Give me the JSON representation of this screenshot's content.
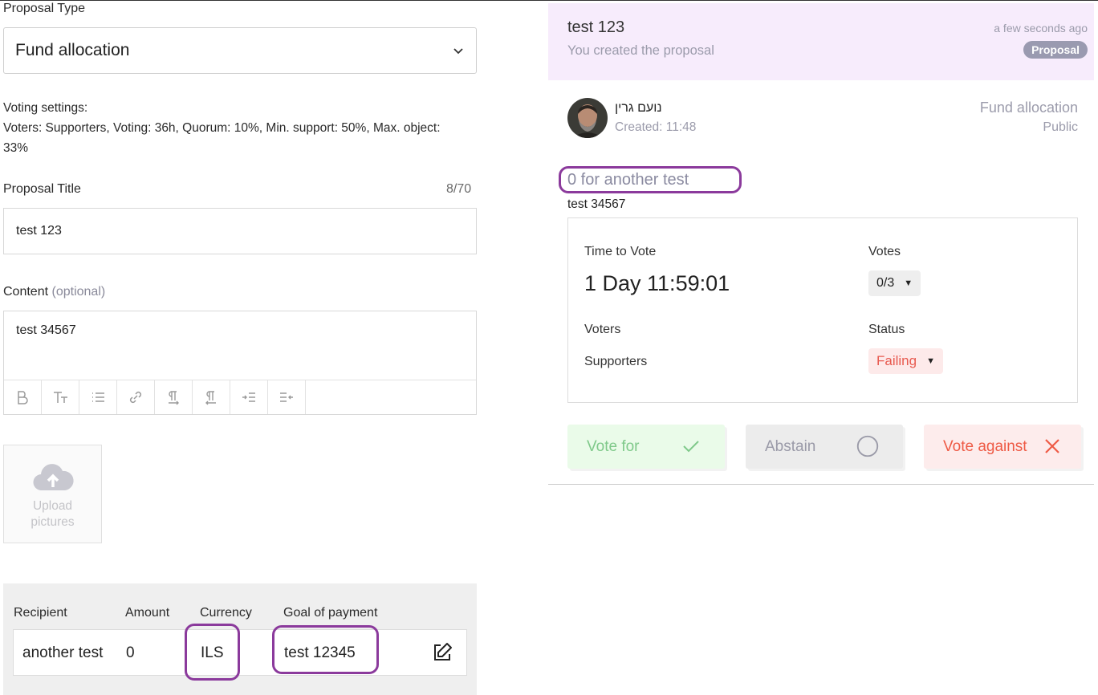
{
  "form": {
    "proposal_type_label": "Proposal Type",
    "proposal_type_value": "Fund allocation",
    "voting_settings_heading": "Voting settings:",
    "voting_settings_text": "Voters: Supporters, Voting: 36h, Quorum: 10%, Min. support: 50%, Max. object: 33%",
    "title_label": "Proposal Title",
    "title_counter": "8/70",
    "title_value": "test 123",
    "content_label": "Content",
    "content_optional": "(optional)",
    "content_value": "test 34567",
    "toolbar_icons": [
      "bold-icon",
      "text-size-icon",
      "list-icon",
      "link-icon",
      "ltr-icon",
      "rtl-icon",
      "indent-icon",
      "outdent-icon"
    ],
    "upload_line1": "Upload",
    "upload_line2": "pictures",
    "table": {
      "headers": [
        "Recipient",
        "Amount",
        "Currency",
        "Goal of payment"
      ],
      "row": {
        "recipient": "another test",
        "amount": "0",
        "currency": "ILS",
        "goal": "test 12345"
      }
    }
  },
  "preview": {
    "title": "test 123",
    "subtitle": "You created the proposal",
    "time": "a few seconds ago",
    "badge": "Proposal",
    "author": "נועם גרין",
    "created": "Created: 11:48",
    "proposal_type": "Fund allocation",
    "visibility": "Public",
    "funding_title": "0 for another test",
    "content": "test 34567",
    "card": {
      "time_label": "Time to Vote",
      "time_value": "1 Day 11:59:01",
      "votes_label": "Votes",
      "votes_value": "0/3",
      "voters_label": "Voters",
      "voters_value": "Supporters",
      "status_label": "Status",
      "status_value": "Failing"
    },
    "buttons": {
      "vote_for": "Vote for",
      "abstain": "Abstain",
      "vote_against": "Vote against"
    }
  },
  "colors": {
    "highlight": "#8b3a9c",
    "header_bg": "#f7ecfc",
    "vote_for": "#7fc98a",
    "vote_against": "#ee5a45",
    "status_failing": "#e85a4f"
  }
}
